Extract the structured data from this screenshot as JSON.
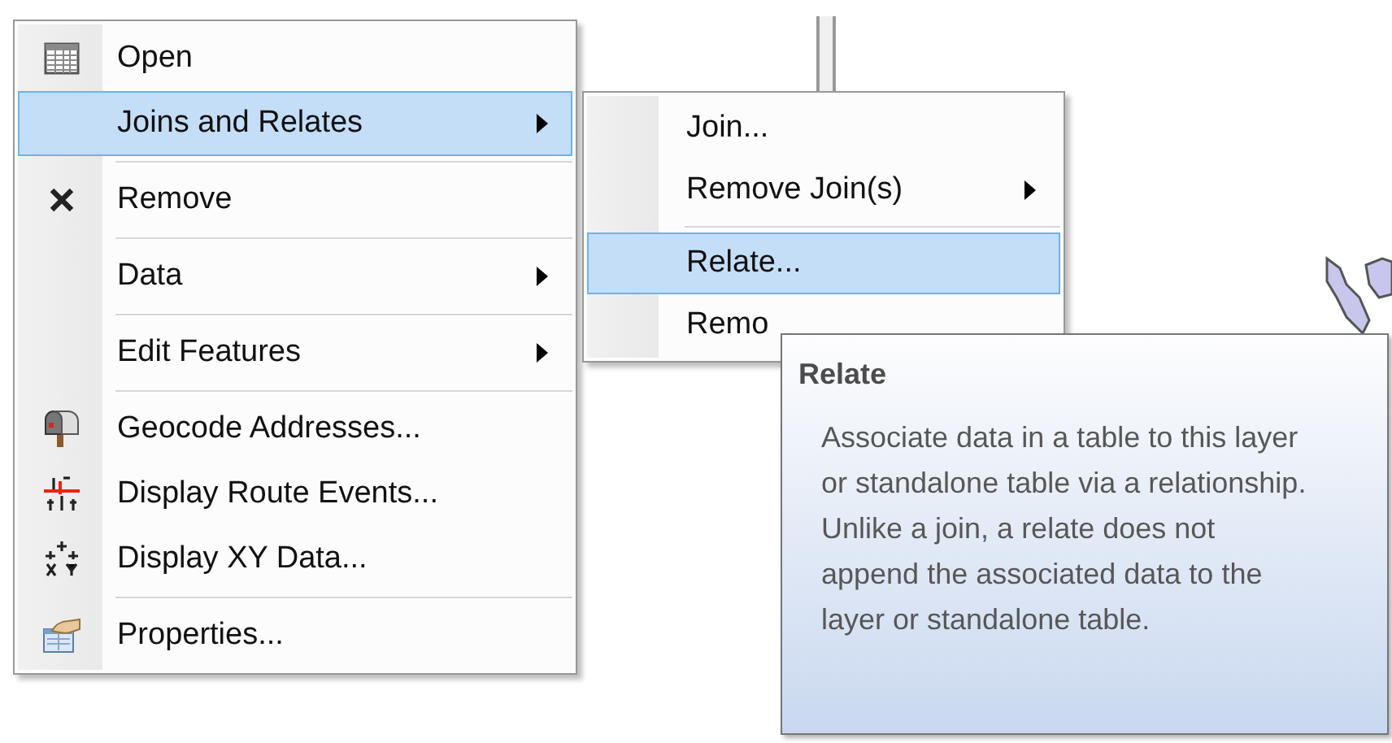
{
  "context_menu": {
    "items": [
      {
        "kind": "item",
        "label": "Open",
        "submenu": false,
        "selected": false
      },
      {
        "kind": "item",
        "label": "Joins and Relates",
        "submenu": true,
        "selected": true
      },
      {
        "kind": "separator"
      },
      {
        "kind": "item",
        "label": "Remove",
        "submenu": false,
        "selected": false
      },
      {
        "kind": "separator"
      },
      {
        "kind": "item",
        "label": "Data",
        "submenu": true,
        "selected": false
      },
      {
        "kind": "separator"
      },
      {
        "kind": "item",
        "label": "Edit Features",
        "submenu": true,
        "selected": false
      },
      {
        "kind": "separator"
      },
      {
        "kind": "item",
        "label": "Geocode Addresses...",
        "submenu": false,
        "selected": false
      },
      {
        "kind": "item",
        "label": "Display Route Events...",
        "submenu": false,
        "selected": false
      },
      {
        "kind": "item",
        "label": "Display XY Data...",
        "submenu": false,
        "selected": false
      },
      {
        "kind": "separator"
      },
      {
        "kind": "item",
        "label": "Properties...",
        "submenu": false,
        "selected": false
      }
    ]
  },
  "submenu": {
    "items": [
      {
        "kind": "item",
        "label": "Join...",
        "submenu": false,
        "selected": false
      },
      {
        "kind": "item",
        "label": "Remove Join(s)",
        "submenu": true,
        "selected": false
      },
      {
        "kind": "separator"
      },
      {
        "kind": "item",
        "label": "Relate...",
        "submenu": false,
        "selected": true
      },
      {
        "kind": "item",
        "label": "Remo",
        "submenu": false,
        "selected": false
      }
    ]
  },
  "tooltip": {
    "title": "Relate",
    "body": "Associate data in a table to this layer or standalone table via a relationship. Unlike a join, a relate does not append the associated data to the layer or standalone table."
  }
}
